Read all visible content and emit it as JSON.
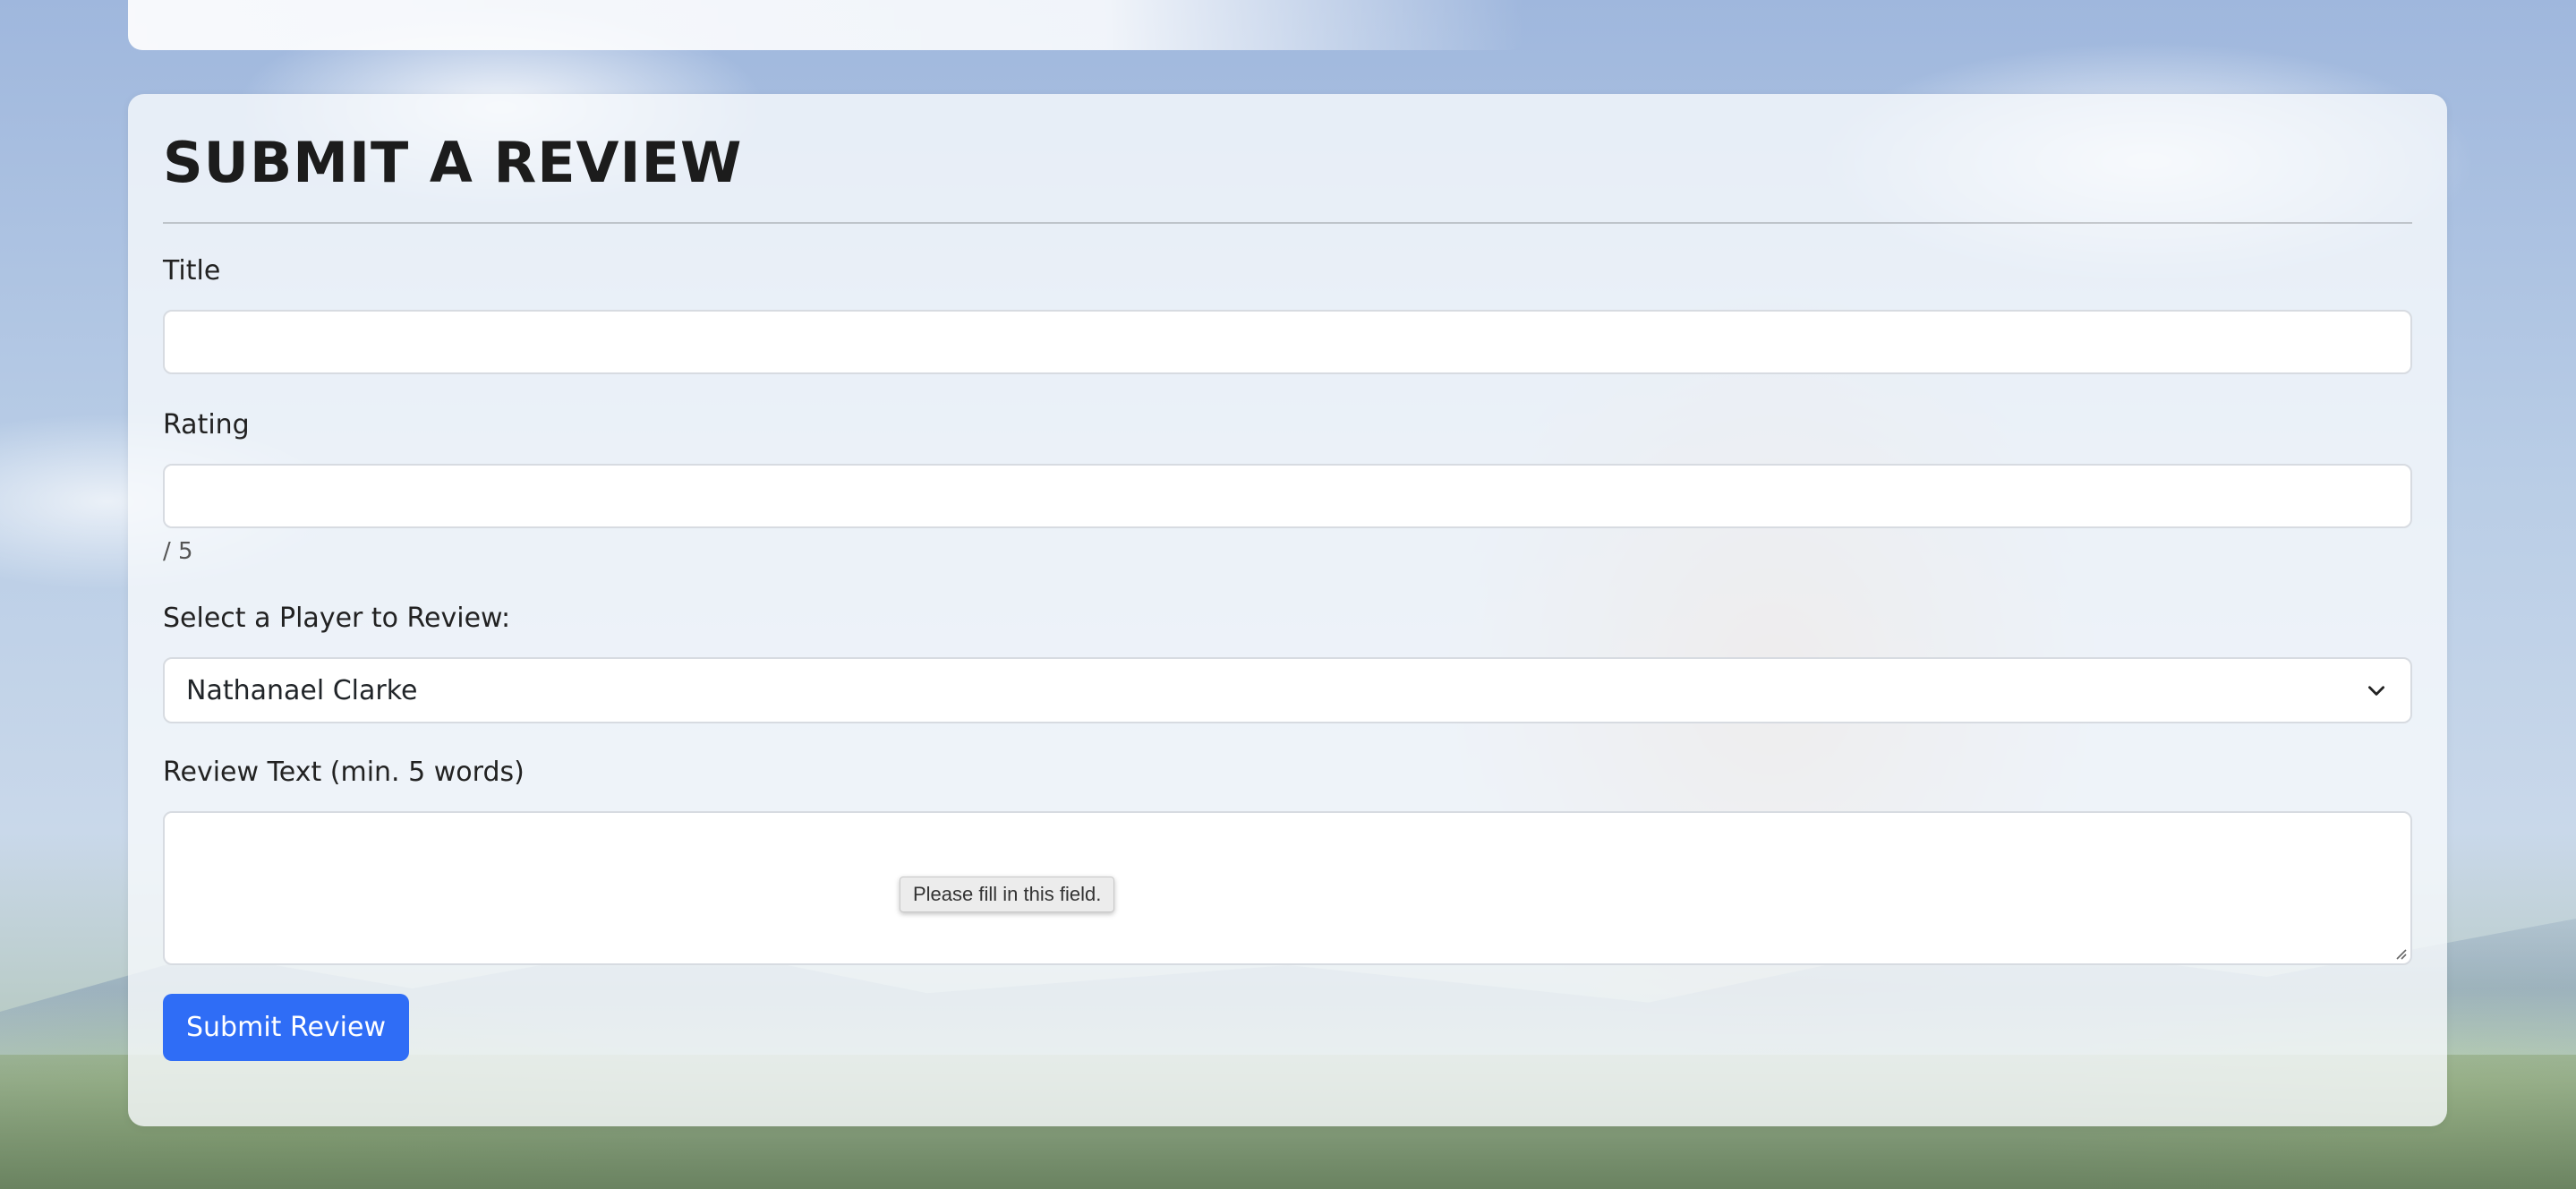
{
  "page": {
    "heading": "SUBMIT A REVIEW"
  },
  "form": {
    "title": {
      "label": "Title",
      "value": ""
    },
    "rating": {
      "label": "Rating",
      "value": "",
      "suffix": "/ 5"
    },
    "player": {
      "label": "Select a Player to Review:",
      "selected": "Nathanael Clarke"
    },
    "review_text": {
      "label": "Review Text (min. 5 words)",
      "value": ""
    },
    "validation_tooltip": "Please fill in this field.",
    "submit_label": "Submit Review"
  },
  "colors": {
    "primary_button": "#2f6df6",
    "card_background": "rgba(248,250,253,0.80)"
  },
  "icons": {
    "select_arrow": "chevron-down-icon",
    "resize": "resize-handle-icon"
  }
}
